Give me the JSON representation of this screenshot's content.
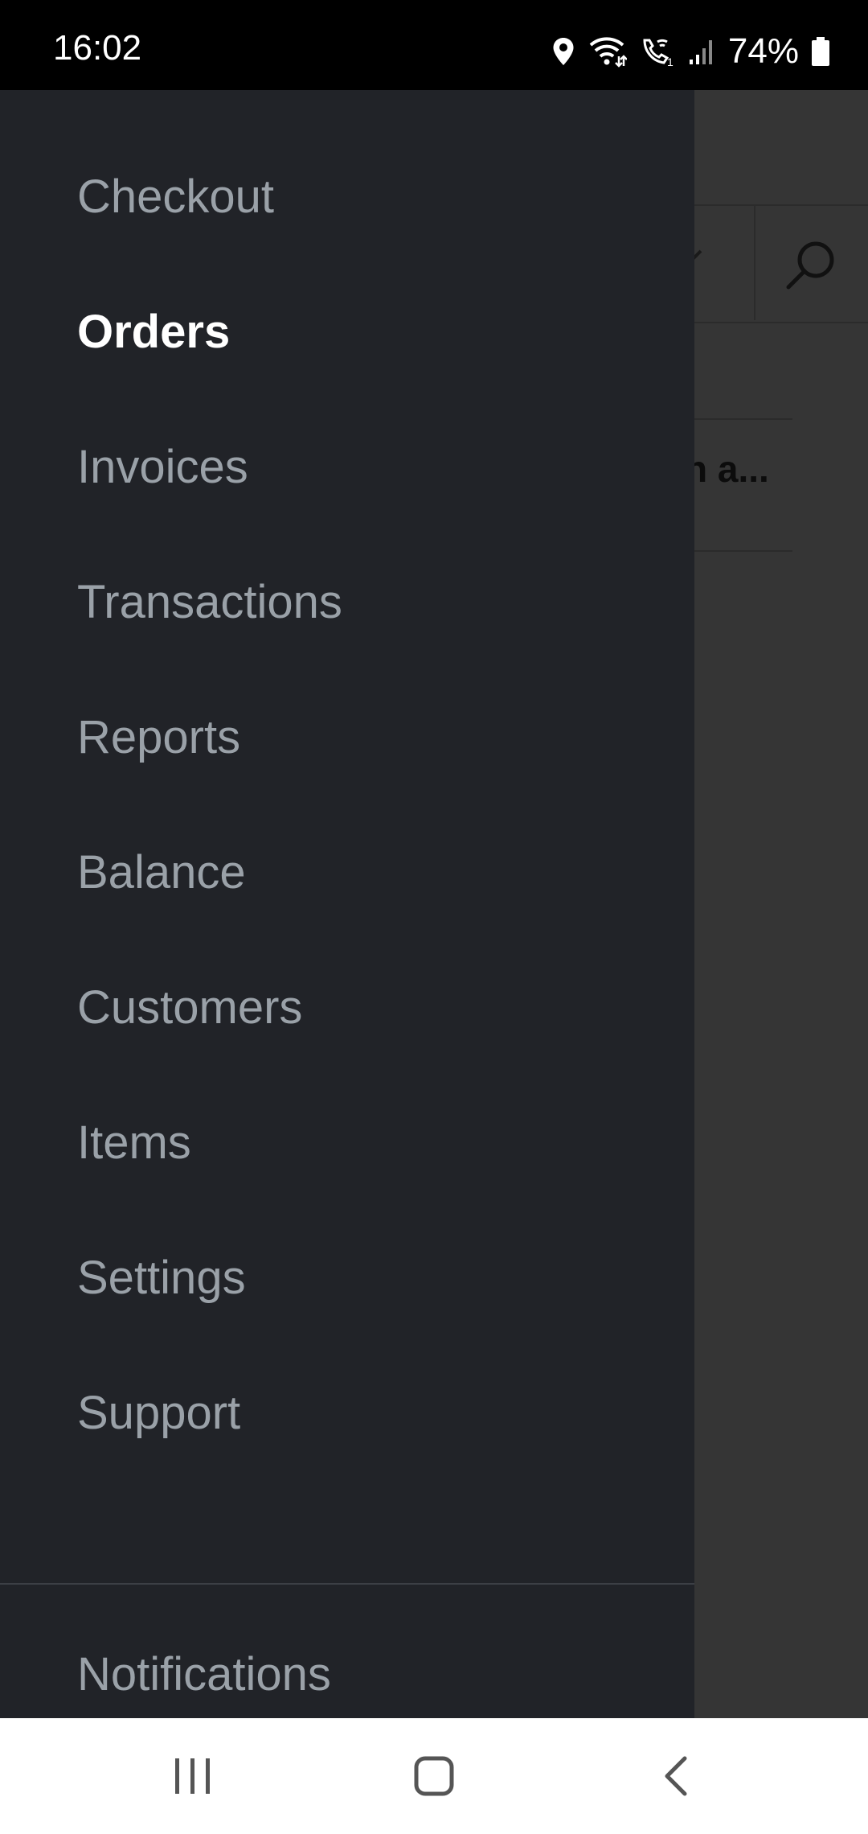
{
  "status_bar": {
    "time": "16:02",
    "battery": "74%",
    "icons": [
      "location-icon",
      "wifi-icon",
      "wifi-call-icon",
      "signal-icon",
      "battery-icon"
    ]
  },
  "background": {
    "row_text": "n a..."
  },
  "drawer": {
    "items": [
      {
        "label": "Checkout",
        "active": false
      },
      {
        "label": "Orders",
        "active": true
      },
      {
        "label": "Invoices",
        "active": false
      },
      {
        "label": "Transactions",
        "active": false
      },
      {
        "label": "Reports",
        "active": false
      },
      {
        "label": "Balance",
        "active": false
      },
      {
        "label": "Customers",
        "active": false
      },
      {
        "label": "Items",
        "active": false
      },
      {
        "label": "Settings",
        "active": false
      },
      {
        "label": "Support",
        "active": false
      }
    ],
    "footer_item": "Notifications"
  },
  "nav_bar": {
    "buttons": [
      "recent-apps-icon",
      "home-icon",
      "back-icon"
    ]
  },
  "colors": {
    "drawer_bg": "#212328",
    "menu_text": "#9aa1a8",
    "active_text": "#ffffff",
    "scrim": "#353535"
  }
}
